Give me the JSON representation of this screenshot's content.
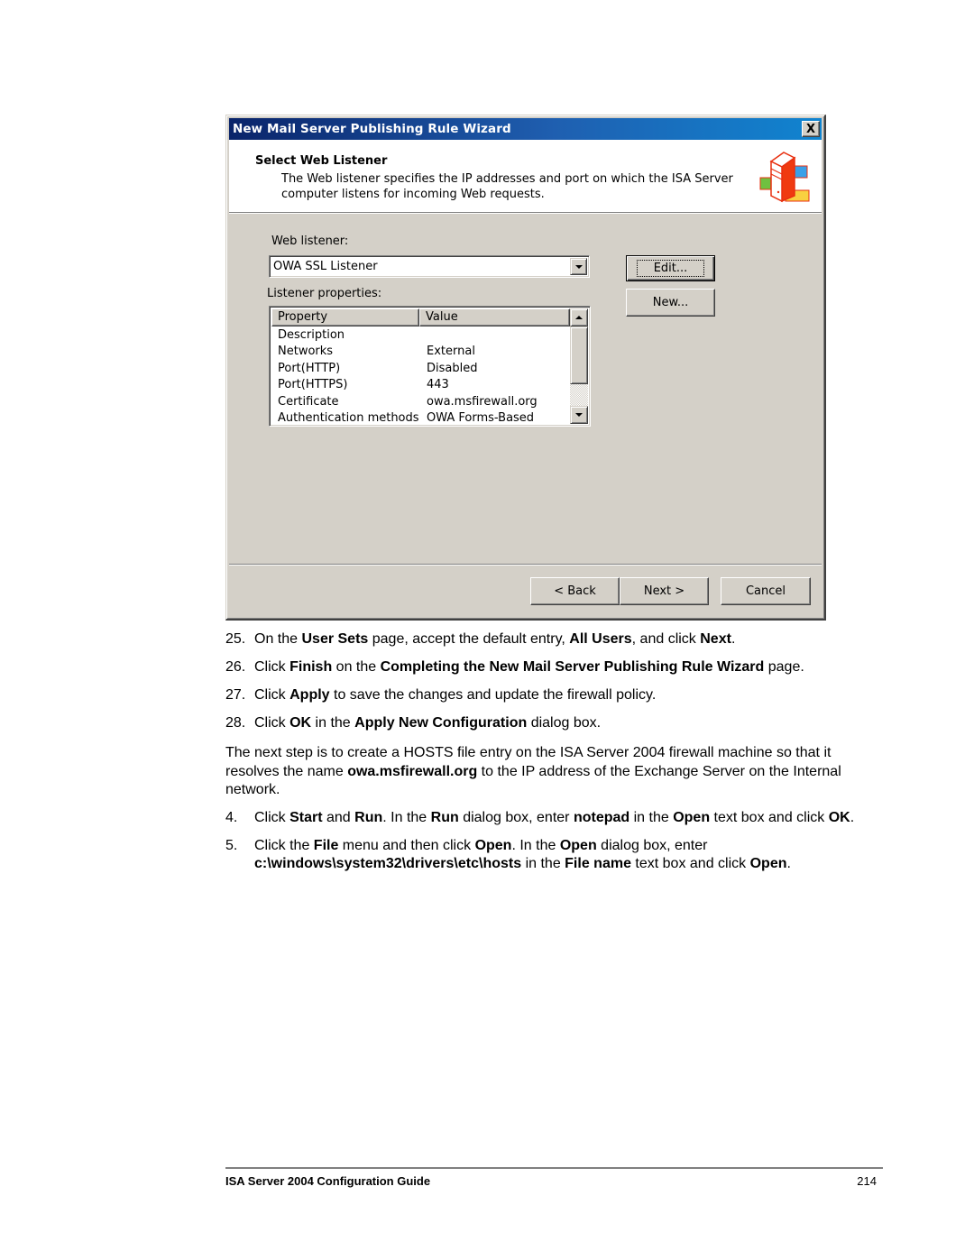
{
  "dialog": {
    "title": "New Mail Server Publishing Rule Wizard",
    "close_label": "X",
    "header": {
      "title": "Select Web Listener",
      "description": "The Web listener specifies the IP addresses and port on which the ISA Server computer listens for incoming Web requests.",
      "icon": "server-network-icon"
    },
    "web_listener_label": "Web listener:",
    "web_listener_value": "OWA SSL Listener",
    "listener_properties_label": "Listener properties:",
    "edit_button": "Edit...",
    "new_button": "New...",
    "table": {
      "headers": [
        "Property",
        "Value"
      ],
      "rows": [
        {
          "property": "Description",
          "value": ""
        },
        {
          "property": "Networks",
          "value": "External"
        },
        {
          "property": "Port(HTTP)",
          "value": "Disabled"
        },
        {
          "property": "Port(HTTPS)",
          "value": "443"
        },
        {
          "property": "Certificate",
          "value": "owa.msfirewall.org"
        },
        {
          "property": "Authentication methods",
          "value": "OWA Forms-Based"
        }
      ]
    },
    "back_button": "< Back",
    "next_button": "Next >",
    "cancel_button": "Cancel"
  },
  "steps_a": [
    {
      "num": "25.",
      "parts": [
        [
          "On the ",
          false
        ],
        [
          "User Sets",
          true
        ],
        [
          " page, accept the default entry, ",
          false
        ],
        [
          "All Users",
          true
        ],
        [
          ", and click ",
          false
        ],
        [
          "Next",
          true
        ],
        [
          ".",
          false
        ]
      ]
    },
    {
      "num": "26.",
      "parts": [
        [
          "Click ",
          false
        ],
        [
          "Finish",
          true
        ],
        [
          " on the ",
          false
        ],
        [
          "Completing the New Mail Server Publishing Rule Wizard",
          true
        ],
        [
          " page.",
          false
        ]
      ]
    },
    {
      "num": "27.",
      "parts": [
        [
          "Click ",
          false
        ],
        [
          "Apply",
          true
        ],
        [
          " to save the changes and update the firewall policy.",
          false
        ]
      ]
    },
    {
      "num": "28.",
      "parts": [
        [
          "Click ",
          false
        ],
        [
          "OK",
          true
        ],
        [
          " in the ",
          false
        ],
        [
          "Apply New Configuration",
          true
        ],
        [
          " dialog box.",
          false
        ]
      ]
    }
  ],
  "paragraph": {
    "parts": [
      [
        "The next step is to create a HOSTS file entry on the ISA Server 2004 firewall machine so that it resolves the name ",
        false
      ],
      [
        "owa.msfirewall.org",
        true
      ],
      [
        " to the IP address of the Exchange Server on the Internal network.",
        false
      ]
    ]
  },
  "steps_b": [
    {
      "num": "4.",
      "parts": [
        [
          "Click ",
          false
        ],
        [
          "Start",
          true
        ],
        [
          " and ",
          false
        ],
        [
          "Run",
          true
        ],
        [
          ". In the ",
          false
        ],
        [
          "Run",
          true
        ],
        [
          " dialog box, enter ",
          false
        ],
        [
          "notepad",
          true
        ],
        [
          " in the ",
          false
        ],
        [
          "Open",
          true
        ],
        [
          " text box and click ",
          false
        ],
        [
          "OK",
          true
        ],
        [
          ".",
          false
        ]
      ]
    },
    {
      "num": "5.",
      "parts": [
        [
          "Click the ",
          false
        ],
        [
          "File",
          true
        ],
        [
          " menu and then click ",
          false
        ],
        [
          "Open",
          true
        ],
        [
          ". In the ",
          false
        ],
        [
          "Open",
          true
        ],
        [
          " dialog box, enter ",
          false
        ],
        [
          "c:\\windows\\system32\\drivers\\etc\\hosts",
          true
        ],
        [
          " in the ",
          false
        ],
        [
          "File name",
          true
        ],
        [
          " text box and click ",
          false
        ],
        [
          "Open",
          true
        ],
        [
          ".",
          false
        ]
      ]
    }
  ],
  "footer": {
    "title": "ISA Server 2004 Configuration Guide",
    "page": "214"
  }
}
